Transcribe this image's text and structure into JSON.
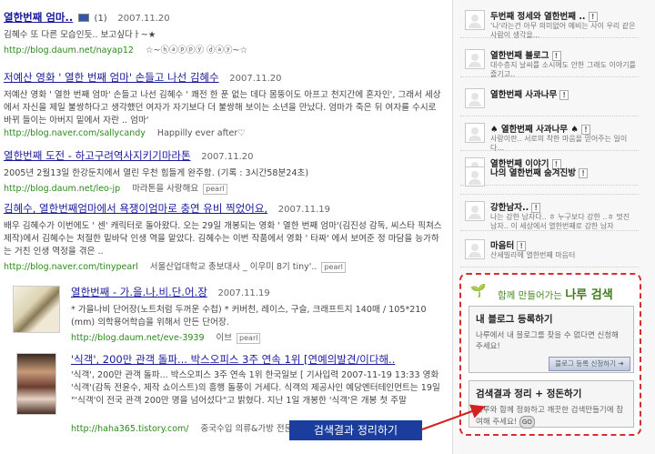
{
  "results": [
    {
      "title": "열한번째 엄마..",
      "count": "(1)",
      "date": "2007.11.20",
      "snippet": "김혜수 또 다른 모습인듯.. 보고싶다ㅏ~★",
      "url": "http://blog.daum.net/nayap12",
      "url_extra": "☆~ⓗⓐⓟⓟⓨ ⓓⓐⓨ~☆"
    },
    {
      "title": "저예산 영화 ' 열한 번째 엄마' 손들고 나선 김혜수",
      "date": "2007.11.20",
      "snippet": "저예산 영화 ' 열한 번째 엄마' 손들고 나선 김혜수 ' 쾌전 한 푼 없는 데다 몸뚱이도 아프고 천지간에 혼자인', 그래서 세상에서 자신을 제일 불쌍하다고 생각했던 여자가 자기보다 더 불쌍해 보이는 소년을 만났다. 엄마가 죽은 뒤 여자를 수시로 바뀌 들이는 아버지 밑에서 자란 .. 엄마'",
      "url": "http://blog.naver.com/sallycandy",
      "url_extra": "Happilly ever after♡"
    },
    {
      "title": "열한번째 도전 - 하고구려역사지키기마라톤",
      "date": "2007.11.20",
      "snippet": "2005년 2월13일 한강둔치에서 열린 우천 힘들게 완주함. (기록 : 3시간58분24초)",
      "url": "http://blog.daum.net/leo-jp",
      "url_extra": "마라톤을 사랑해요"
    },
    {
      "title": "김혜수, 열한번째엄마에서 욕쟁이엄마로 충연 유비 찍었어요,",
      "date": "2007.11.19",
      "snippet": "배우 김혜수가 이번에도 ' 센' 캐릭터로 돌아왔다. 오는 29일 개봉되는 영화 ' 열한 번째 엄마'(김진성 감독, 씨스타 픽쳐스 제작)에서 김혜수는 처절한 밑바닥 인생 역을 맡았다. 김혜수는 이번 작품에서 영화 ' 타짜' 에서 보여준 정 마담을 능가하는 거친 인생 역정을 겪은 ..",
      "url": "http://blog.naver.com/tinypearl",
      "url_extra": "서울산업대학교 총보대사 _ 이우미 8기 tiny'.."
    },
    {
      "title": "열한번째 - 가.을.나.비.단.어.장",
      "date": "2007.11.19",
      "snippet": "* 가을나비 단어장(노트처럼 두꺼운 수첩) * 커버천, 레이스, 구슬, 크래프트지 140매 / 105*210 (mm) 의학용어학습을 위해서 만든 단어장.",
      "url": "http://blog.daum.net/eve-3939",
      "url_extra": "이브"
    },
    {
      "title": "'식객', 200만 관객 돌파... 박스오피스 3주 연속 1위 [연예의발견/이다해..",
      "date": "",
      "snippet": "'식객', 200만 관객 돌파... 박스오피스 3주 연속 1위 한국일보 [ 기사입력 2007-11-19 13:33 영화 '식객'(감독 전윤수, 제작 쇼이스트)의 흥행 돌풍이 거세다. 식객의 제공사인 예당엔터테인먼트는 19일 \"'식객'이 전국 관객 200만 명을 넘어섰다\"고 밝혔다. 지난 1일 개봉한 '식객'은 개봉 첫 주말",
      "url": "http://haha365.tistory.com/",
      "url_extra": "중국수입 의류&가방 전문제작 벤더업"
    }
  ],
  "sidebar": {
    "items": [
      {
        "title": "두번째 정세와 열한번째 ..",
        "desc": "'나'라는건 아무 의미없어 예비는 사이 우리 같은 사람이 생각을..."
      },
      {
        "title": "열한번째 블로그",
        "desc": "대수층지 날씨를 소시에도 안한 그래도 이야기를 즐기고.."
      },
      {
        "title": "열한번째 사과나무",
        "desc": ""
      },
      {
        "title": "♠ 열한번째 사과나무 ♠",
        "desc": "사랑이란.. 서로의 착한 마음을 믿어주는 일이다..."
      },
      {
        "title": "열한번째 이야기",
        "desc": ""
      },
      {
        "title": "나의 열한번째 숨겨진방",
        "desc": ""
      },
      {
        "title": "강한남자..",
        "desc": "나는 강한 남자다.. ㅎ 누구보다 강한 ..ㅎ 멋진 남자.. 이 세상에서 열한번째로 강한 남자"
      },
      {
        "title": "마음터",
        "desc": "산세빌라에 열한번째 마음터"
      }
    ]
  },
  "promo": {
    "heading_small": "함께 만들어가는",
    "heading_bold": "나루 검색",
    "box1_title": "내 블로그 등록하기",
    "box1_desc": "나루에서 내 블로그를 찾을 수 없다면 신청해 주세요!",
    "box1_button": "블로그 등록 신청하기",
    "box2_title": "검색결과 정리 + 정돈하기",
    "box2_desc": "나루와 함께 정화하고 깨끗한 검색만들기에 참여해 주세요!",
    "box2_go": "GO"
  },
  "annotation": "검색결과 정리하기",
  "colors": {
    "annotation_bg": "#1a3d9e",
    "promo_border": "#d43030",
    "link": "#1a1a9c",
    "url": "#2a8a1a"
  }
}
